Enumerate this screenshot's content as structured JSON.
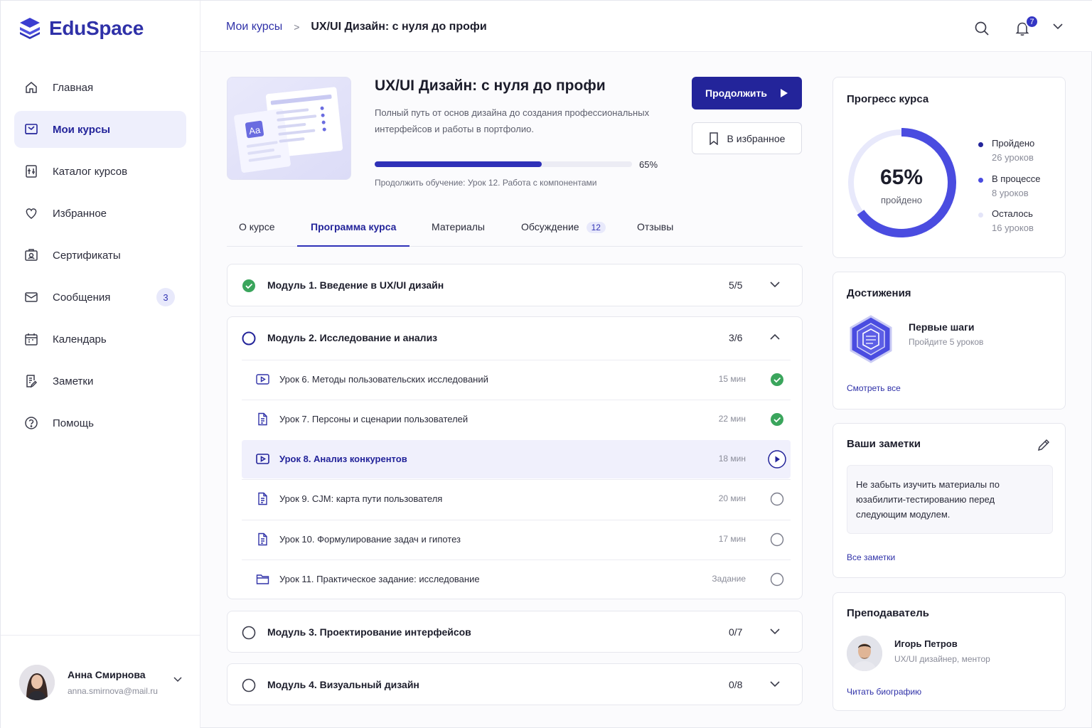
{
  "brand": {
    "name": "EduSpace"
  },
  "sidebar": {
    "items": [
      {
        "label": "Главная",
        "icon": "home-icon"
      },
      {
        "label": "Мои курсы",
        "icon": "courses-icon",
        "active": true
      },
      {
        "label": "Каталог курсов",
        "icon": "catalog-icon"
      },
      {
        "label": "Избранное",
        "icon": "heart-icon"
      },
      {
        "label": "Сертификаты",
        "icon": "certificate-icon"
      },
      {
        "label": "Сообщения",
        "icon": "mail-icon",
        "badge": "3"
      },
      {
        "label": "Календарь",
        "icon": "calendar-icon"
      },
      {
        "label": "Заметки",
        "icon": "notes-icon"
      },
      {
        "label": "Помощь",
        "icon": "help-icon"
      }
    ],
    "user": {
      "name": "Анна Смирнова",
      "email": "anna.smirnova@mail.ru"
    }
  },
  "topbar": {
    "breadcrumb_link": "Мои курсы",
    "breadcrumb_current": "UX/UI Дизайн: с нуля до профи",
    "notifications_count": "7"
  },
  "course": {
    "title": "UX/UI Дизайн: с нуля до профи",
    "description": "Полный путь от основ дизайна до создания профессиональных интерфейсов и работы в портфолио.",
    "progress_value": 0.65,
    "progress_label": "65%",
    "continue_text": "Продолжить обучение: Урок 12. Работа с компонентами",
    "thumb_text": "Aa",
    "continue_button": "Продолжить",
    "favorite_button": "В избранное"
  },
  "tabs": [
    {
      "label": "О курсе"
    },
    {
      "label": "Программа курса",
      "active": true
    },
    {
      "label": "Материалы"
    },
    {
      "label": "Обсуждение",
      "badge": "12"
    },
    {
      "label": "Отзывы"
    }
  ],
  "modules": [
    {
      "title": "Модуль 1. Введение в UX/UI дизайн",
      "count": "5/5",
      "status": "completed",
      "expanded": false
    },
    {
      "title": "Модуль 2. Исследование и анализ",
      "count": "3/6",
      "status": "in-progress",
      "expanded": true,
      "lessons": [
        {
          "title": "Урок 6.  Методы пользовательских исследований",
          "duration": "15 мин",
          "type": "video",
          "status": "done"
        },
        {
          "title": "Урок 7.  Персоны и сценарии пользователей",
          "duration": "22 мин",
          "type": "doc",
          "status": "done"
        },
        {
          "title": "Урок 8.  Анализ конкурентов",
          "duration": "18 мин",
          "type": "video",
          "status": "current"
        },
        {
          "title": "Урок 9.  CJM: карта пути пользователя",
          "duration": "20 мин",
          "type": "doc",
          "status": "todo"
        },
        {
          "title": "Урок 10. Формулирование задач и гипотез",
          "duration": "17 мин",
          "type": "doc",
          "status": "todo"
        },
        {
          "title": "Урок 11. Практическое задание: исследование",
          "duration": "Задание",
          "type": "folder",
          "status": "todo"
        }
      ]
    },
    {
      "title": "Модуль 3.  Проектирование интерфейсов",
      "count": "0/7",
      "status": "todo",
      "expanded": false
    },
    {
      "title": "Модуль 4.  Визуальный дизайн",
      "count": "0/8",
      "status": "todo",
      "expanded": false
    }
  ],
  "progress_card": {
    "title": "Прогресс курса",
    "percent_value": 0.65,
    "percent_label": "65%",
    "percent_caption": "пройдено",
    "legend": [
      {
        "label": "Пройдено",
        "sub": "26 уроков",
        "color": "#23249a"
      },
      {
        "label": "В процессе",
        "sub": "8 уроков",
        "color": "#4a4ce0"
      },
      {
        "label": "Осталось",
        "sub": "16 уроков",
        "color": "#e3e4f8"
      }
    ]
  },
  "achievements": {
    "title": "Достижения",
    "name": "Первые шаги",
    "sub": "Пройдите 5 уроков",
    "link": "Смотреть все"
  },
  "notes": {
    "title": "Ваши заметки",
    "text": "Не забыть изучить материалы по юзабилити-тестированию перед следующим модулем.",
    "link": "Все заметки"
  },
  "teacher": {
    "title": "Преподаватель",
    "name": "Игорь Петров",
    "role": "UX/UI дизайнер, ментор",
    "link": "Читать биографию"
  },
  "colors": {
    "accent": "#23249a",
    "accent_light": "#eeeffc",
    "success": "#3aa55c"
  }
}
